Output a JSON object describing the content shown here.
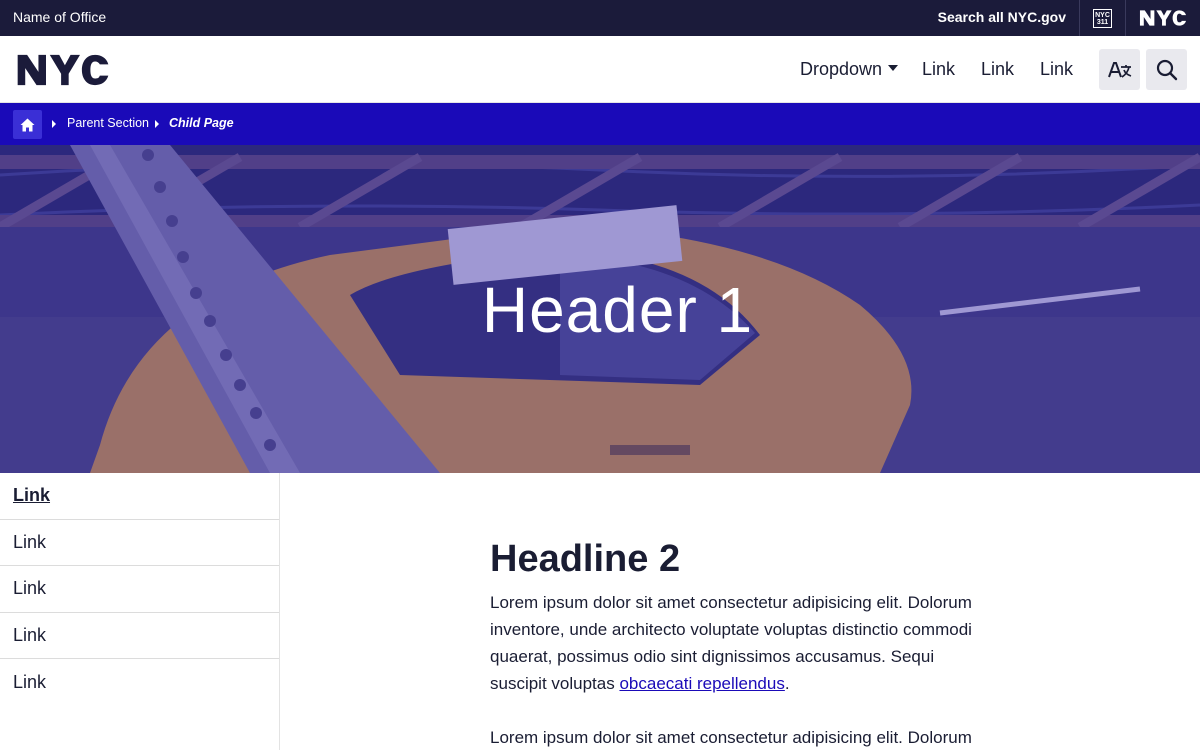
{
  "topbar": {
    "office_name": "Name of Office",
    "search_all": "Search all NYC.gov",
    "icon_311": "nyc-311-icon",
    "nyc_logo": "nyc-logo"
  },
  "header": {
    "logo": "NYC",
    "nav": {
      "dropdown": "Dropdown",
      "links": [
        "Link",
        "Link",
        "Link"
      ]
    },
    "translate_icon": "translate-icon",
    "search_icon": "search-icon"
  },
  "breadcrumb": {
    "home_icon": "home-icon",
    "parent": "Parent Section",
    "current": "Child Page"
  },
  "hero": {
    "title": "Header 1"
  },
  "sidenav": {
    "items": [
      "Link",
      "Link",
      "Link",
      "Link",
      "Link"
    ]
  },
  "content": {
    "headline": "Headline 2",
    "p1_before_link": "Lorem ipsum dolor sit amet consectetur adipisicing elit. Dolorum inventore, unde architecto voluptate voluptas distinctio commodi quaerat, possimus odio sint dignissimos accusamus. Sequi suscipit voluptas ",
    "p1_link": "obcaecati repellendus",
    "p1_after_link": ".",
    "p2": "Lorem ipsum dolor sit amet consectetur adipisicing elit. Dolorum"
  },
  "colors": {
    "topbar_bg": "#1b1b3a",
    "breadcrumb_bg": "#1a0ab8",
    "text": "#1a1d33",
    "link": "#1a0ab8"
  }
}
